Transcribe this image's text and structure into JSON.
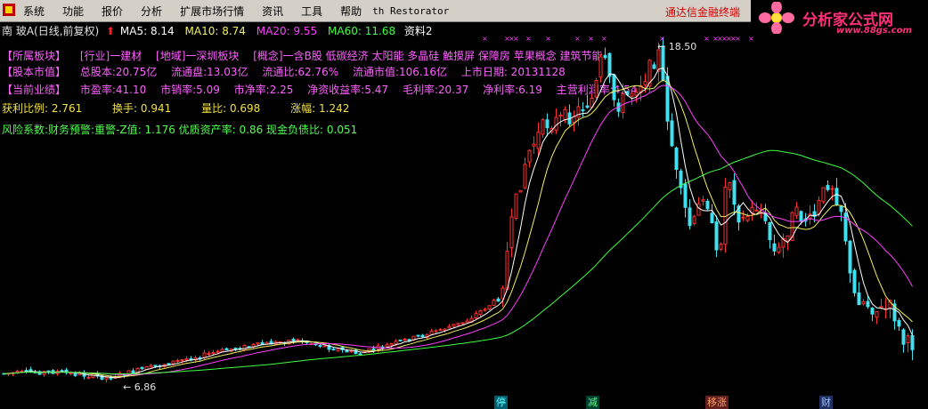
{
  "menu": {
    "items": [
      "系统",
      "功能",
      "报价",
      "分析",
      "扩展市场行情",
      "资讯",
      "工具",
      "帮助"
    ],
    "extra": "th Restorator",
    "margin_link": "通达信金融终端"
  },
  "logo": {
    "text": "分析家公式网",
    "url": "www.88gs.com"
  },
  "ma_row": {
    "stock": "南 玻A(日线,前复权)",
    "ma5": "MA5: 8.14",
    "ma10": "MA10: 8.74",
    "ma20": "MA20: 9.55",
    "ma60": "MA60: 11.68",
    "data": "资料2"
  },
  "info": {
    "sector": [
      "【所属板块】",
      "[行业]一建材",
      "[地域]一深圳板块",
      "[概念]一含B股 低碳经济 太阳能 多晶硅 触摸屏 保障房 苹果概念 建筑节能"
    ],
    "capital": [
      "【股本市值】",
      "总股本:20.75亿",
      "流通盘:13.03亿",
      "流通比:62.76%",
      "流通市值:106.16亿",
      "上市日期: 20131128"
    ],
    "perf": [
      "【当前业绩】",
      "市盈率:41.10",
      "市销率:5.09",
      "市净率:2.25",
      "净资收益率:5.47",
      "毛利率:20.37",
      "净利率:6.19",
      "主营利润率:4.54"
    ],
    "stats": [
      "获利比例: 2.761",
      "换手: 0.941",
      "量比: 0.698",
      "涨幅: 1.242"
    ],
    "risk": "风险系数:财务预警:重警-Z值: 1.176 优质资产率: 0.86 现金负债比: 0.051"
  },
  "annotations": {
    "high": "18.50",
    "low": "6.86"
  },
  "flags": [
    "停",
    "",
    "减",
    "移涨",
    "财"
  ],
  "colors": {
    "up": "#ff3030",
    "down": "#40e0f0",
    "ma5": "#ffffff",
    "ma10": "#f0f060",
    "ma20": "#ff40ff",
    "ma60": "#40ff40"
  }
}
